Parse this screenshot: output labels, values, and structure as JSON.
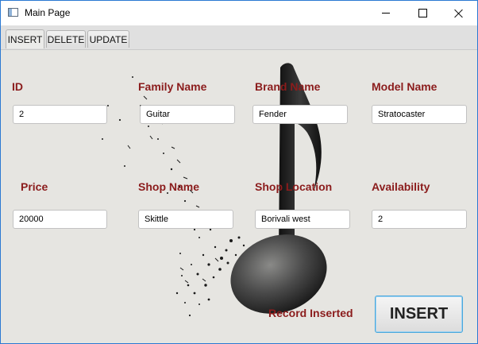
{
  "window": {
    "title": "Main Page"
  },
  "tabs": [
    "INSERT",
    "DELETE",
    "UPDATE"
  ],
  "form": {
    "id": {
      "label": "ID",
      "value": "2"
    },
    "family_name": {
      "label": "Family Name",
      "value": "Guitar"
    },
    "brand_name": {
      "label": "Brand Name",
      "value": "Fender"
    },
    "model_name": {
      "label": "Model Name",
      "value": "Stratocaster"
    },
    "price": {
      "label": "Price",
      "value": "20000"
    },
    "shop_name": {
      "label": "Shop Name",
      "value": "Skittle"
    },
    "shop_location": {
      "label": "Shop Location",
      "value": "Borivali west"
    },
    "availability": {
      "label": "Availability",
      "value": "2"
    }
  },
  "status_text": "Record Inserted",
  "insert_button": "INSERT",
  "colors": {
    "label": "#8b1c1c",
    "background": "#e6e5e1",
    "window_border": "#2b79d2",
    "button_focus": "#49a7dc"
  },
  "icons": [
    "app-window-icon",
    "minimize-icon",
    "maximize-icon",
    "close-icon",
    "music-note-artwork"
  ]
}
